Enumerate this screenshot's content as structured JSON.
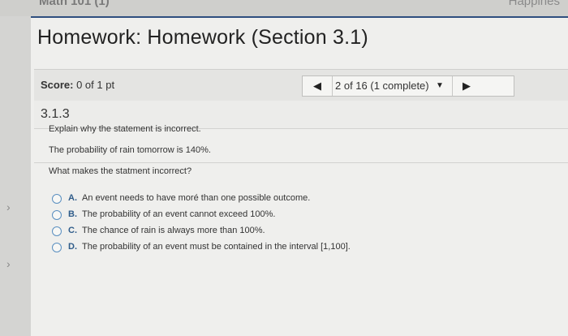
{
  "browser": {
    "left_tab": "Math 101 (1)",
    "right_tab": "Happines"
  },
  "gutter": {
    "arrow_glyph": "›"
  },
  "header": {
    "title": "Homework: Homework (Section 3.1)"
  },
  "score": {
    "label": "Score:",
    "value": "0 of 1 pt"
  },
  "nav": {
    "prev_glyph": "◀",
    "position_label": "2 of 16 (1 complete)",
    "dropdown_glyph": "▼",
    "next_glyph": "▶"
  },
  "question": {
    "number": "3.1.3",
    "instruction": "Explain why the statement is incorrect.",
    "statement": "The probability of rain tomorrow is 140%.",
    "prompt": "What makes the statment incorrect?",
    "options": [
      {
        "letter": "A.",
        "text": "An event needs to have moré than one possible outcome."
      },
      {
        "letter": "B.",
        "text": "The probability of an event cannot exceed 100%."
      },
      {
        "letter": "C.",
        "text": "The chance of rain is always more than 100%."
      },
      {
        "letter": "D.",
        "text": "The probability of an event must be contained in the interval [1,100]."
      }
    ]
  },
  "colors": {
    "accent": "#2f4f7f",
    "option_letter": "#2f5c8a",
    "radio_border": "#5a8fc0"
  }
}
